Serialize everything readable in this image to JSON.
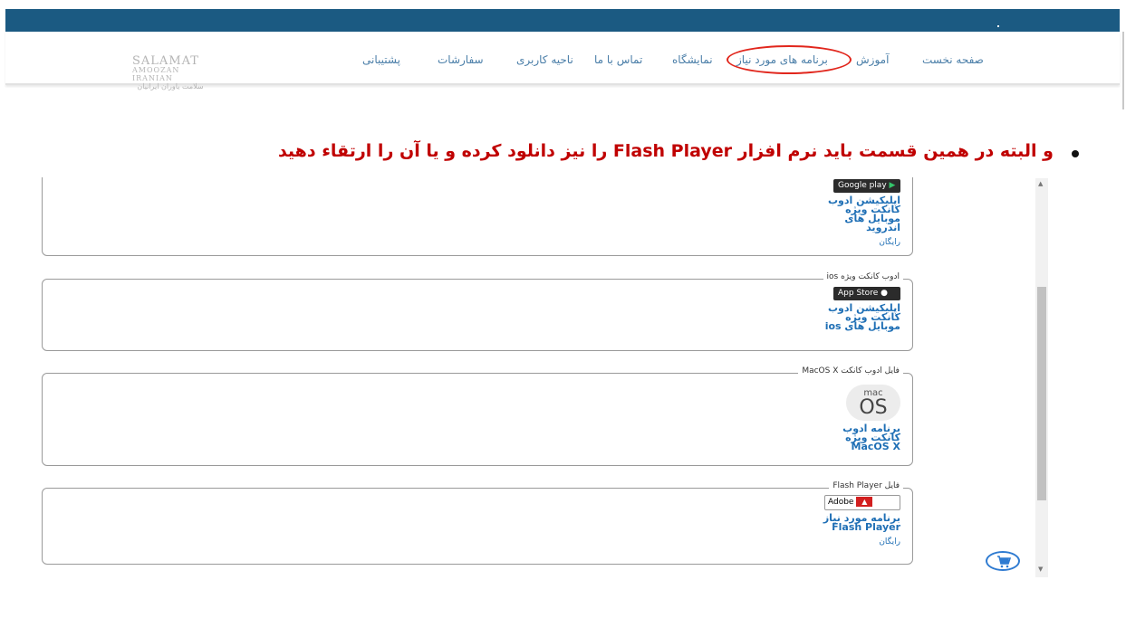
{
  "header": {
    "logo_line1": "SALAMAT",
    "logo_line2": "AMOOZAN IRANIAN",
    "logo_line3": "سلامت یاوران ایرانیان"
  },
  "nav": {
    "items": [
      {
        "label": "صفحه نخست"
      },
      {
        "label": "آموزش"
      },
      {
        "label": "برنامه های مورد نیاز"
      },
      {
        "label": "نمایشگاه"
      },
      {
        "label": "تماس با ما"
      },
      {
        "label": "ناحیه کاربری"
      },
      {
        "label": "سفارشات"
      },
      {
        "label": "پشتیبانی"
      }
    ],
    "highlight_color": "#e1261c"
  },
  "instruction": {
    "text": "و البته در همین قسمت باید نرم افزار Flash Player را نیز دانلود کرده و  یا آن را ارتقاء دهید",
    "color": "#c00000"
  },
  "downloads": [
    {
      "legend": "",
      "badge": "Google play",
      "title": "اپلیکیشن ادوب کانکت ویژه موبایل های اندروید",
      "price": "رایگان"
    },
    {
      "legend": "ادوب کانکت ویژه ios",
      "badge": "App Store",
      "title": "اپلیکیشن ادوب کانکت ویژه موبایل های ios",
      "price": ""
    },
    {
      "legend": "فایل ادوب کانکت MacOS X",
      "badge_mac": "mac",
      "badge_os": "OS",
      "title": "برنامه ادوب کانکت ویژه MacOS X",
      "price": ""
    },
    {
      "legend": "فایل Flash Player",
      "badge": "Adobe",
      "title": "برنامه مورد نیاز Flash Player",
      "price": "رایگان"
    }
  ],
  "icons": {
    "cart": "shopping-cart-icon",
    "play": "google-play-icon",
    "apple": "apple-icon"
  }
}
